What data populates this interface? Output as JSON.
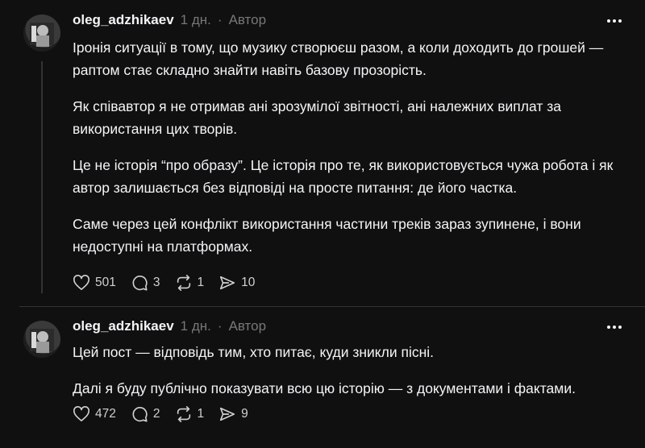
{
  "posts": [
    {
      "username": "oleg_adzhikaev",
      "time": "1 дн.",
      "separator": "·",
      "role": "Автор",
      "paragraphs": [
        "Іронія ситуації в тому, що музику створюєш разом, а коли доходить до грошей — раптом стає складно знайти навіть базову прозорість.",
        "Як співавтор я не отримав ані зрозумілої звітності, ані належних виплат за використання цих творів.",
        "Це не історія “про образу”. Це історія про те, як використовується чужа робота і як автор залишається без відповіді на просте питання: де його частка.",
        "Саме через цей конфлікт використання частини треків зараз зупинене, і вони недоступні на платформах."
      ],
      "likes": "501",
      "replies": "3",
      "reposts": "1",
      "shares": "10"
    },
    {
      "username": "oleg_adzhikaev",
      "time": "1 дн.",
      "separator": "·",
      "role": "Автор",
      "paragraphs": [
        "Цей пост — відповідь тим, хто питає, куди зникли пісні.",
        "Далі я буду публічно показувати всю цю історію — з документами і фактами."
      ],
      "likes": "472",
      "replies": "2",
      "reposts": "1",
      "shares": "9"
    }
  ],
  "icons": {
    "like": "heart-icon",
    "reply": "comment-icon",
    "repost": "repost-icon",
    "share": "share-icon",
    "more": "more-dots-icon"
  },
  "colors": {
    "background": "#101010",
    "text": "#f3f5f7",
    "muted": "#777777"
  }
}
